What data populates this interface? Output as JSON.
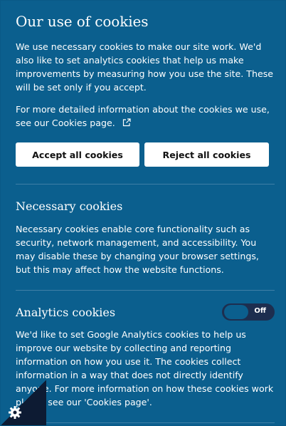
{
  "banner": {
    "title": "Our use of cookies",
    "intro": "We use necessary cookies to make our site work. We'd also like to set analytics cookies that help us make improvements by measuring how you use the site. These will be set only if you accept.",
    "more_info": "For more detailed information about the cookies we use, see our Cookies page."
  },
  "buttons": {
    "accept_label": "Accept all cookies",
    "reject_label": "Reject all cookies"
  },
  "necessary": {
    "heading": "Necessary cookies",
    "text": "Necessary cookies enable core functionality such as security, network management, and accessibility. You may disable these by changing your browser settings, but this may affect how the website functions."
  },
  "analytics": {
    "heading": "Analytics cookies",
    "toggle_label": "Off",
    "text": "We'd like to set Google Analytics cookies to help us improve our website by collecting and reporting information on how you use it. The cookies collect information in a way that does not directly identify anyone. For more information on how these cookies work please see our 'Cookies page'."
  },
  "icons": {
    "external_link": "external-link-icon",
    "settings": "gear-icon"
  },
  "colors": {
    "panel_bg": "#0b5f8e",
    "toggle_bg": "#1d2e4f",
    "corner_bg": "#0d1b33"
  }
}
